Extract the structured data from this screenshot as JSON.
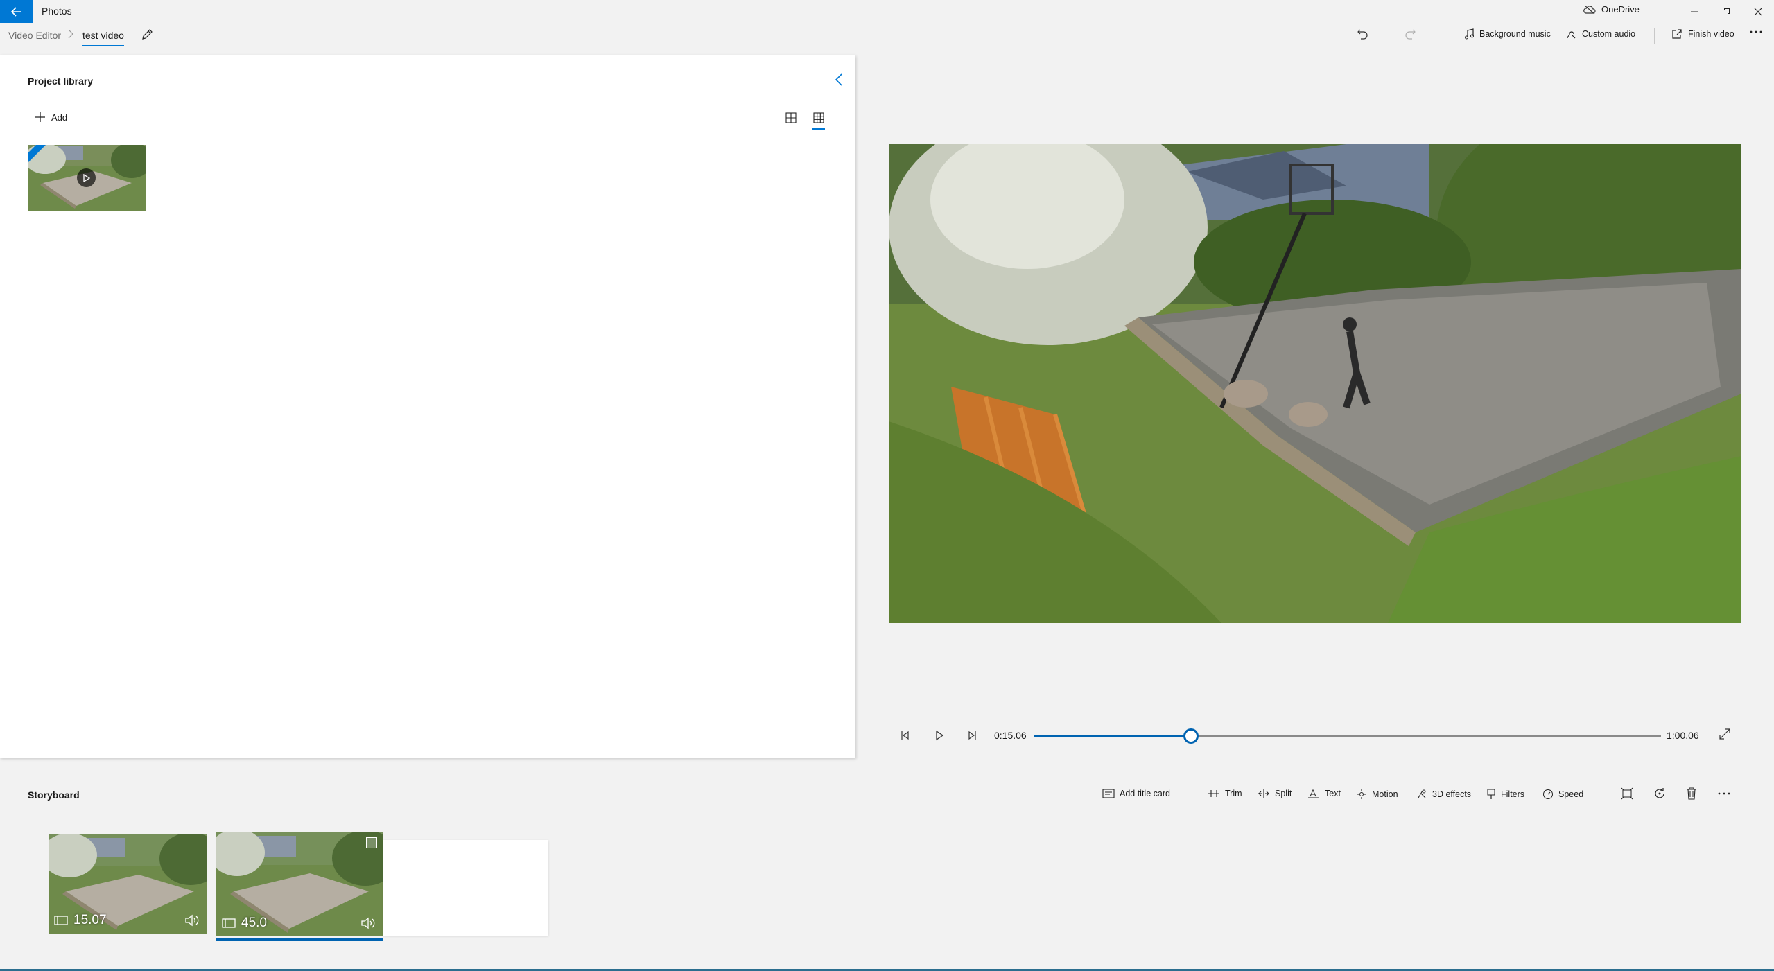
{
  "titlebar": {
    "app_name": "Photos",
    "onedrive_label": "OneDrive"
  },
  "breadcrumb": {
    "root": "Video Editor",
    "separator": ">",
    "current": "test video"
  },
  "toolbar": {
    "background_music": "Background music",
    "custom_audio": "Custom audio",
    "finish_video": "Finish video"
  },
  "library": {
    "title": "Project library",
    "add_label": "Add"
  },
  "playback": {
    "current_time": "0:15.06",
    "total_time": "1:00.06",
    "progress_fraction": 0.25
  },
  "storyboard": {
    "title": "Storyboard",
    "tools": {
      "add_title_card": "Add title card",
      "trim": "Trim",
      "split": "Split",
      "text": "Text",
      "motion": "Motion",
      "effects_3d": "3D effects",
      "filters": "Filters",
      "speed": "Speed"
    },
    "clips": [
      {
        "duration": "15.07",
        "selected": false
      },
      {
        "duration": "45.0",
        "selected": true
      }
    ]
  },
  "colors": {
    "accent": "#0078d4",
    "accent_dark": "#0063b1",
    "panel": "#ffffff",
    "background": "#f2f2f2"
  }
}
